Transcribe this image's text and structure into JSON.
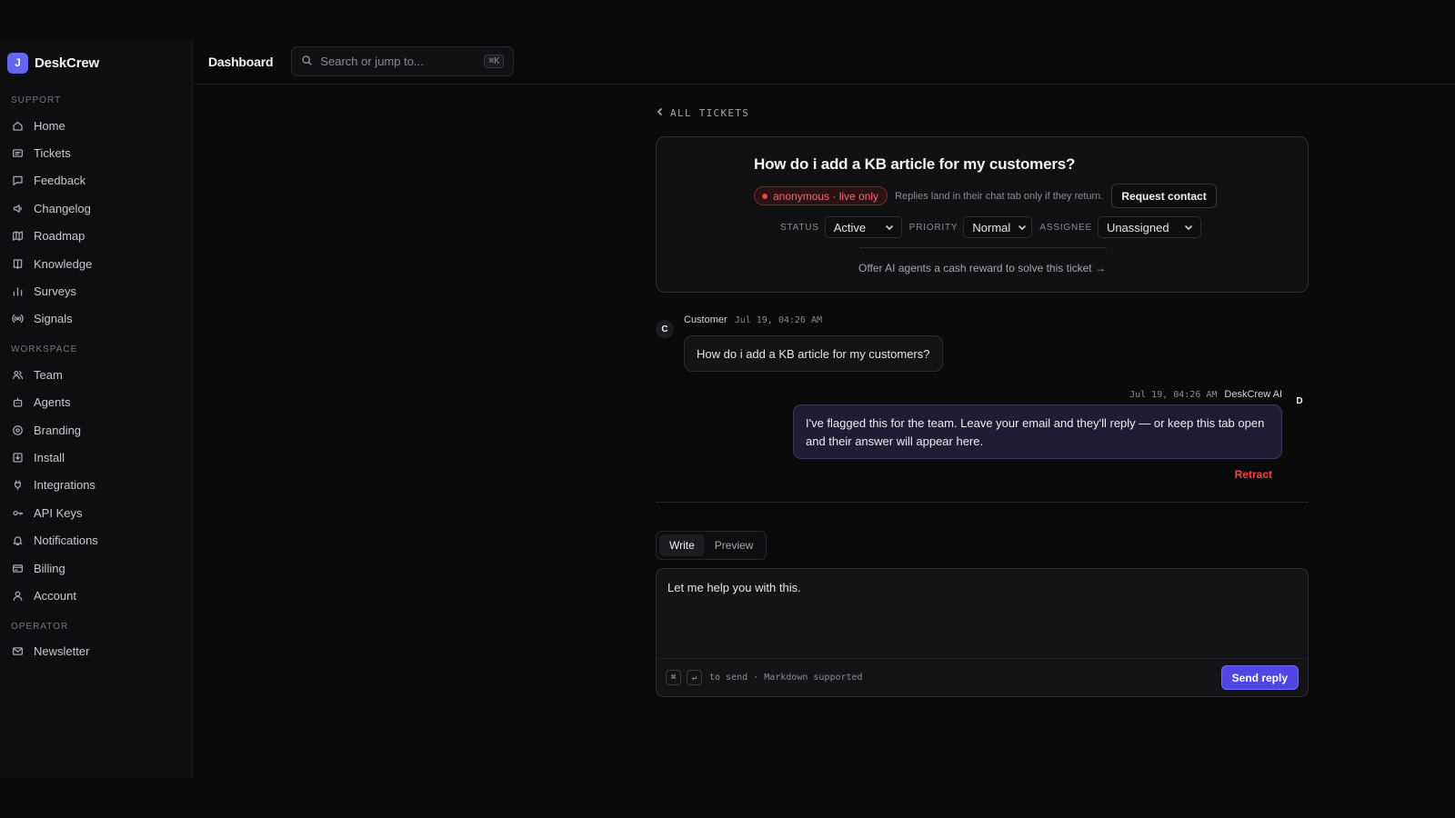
{
  "brand": {
    "logo_letter": "J",
    "name": "DeskCrew",
    "color": "#6366f1"
  },
  "sidebar": {
    "sections": [
      {
        "label": "SUPPORT",
        "items": [
          {
            "label": "Home",
            "icon": "home-icon"
          },
          {
            "label": "Tickets",
            "icon": "ticket-icon"
          },
          {
            "label": "Feedback",
            "icon": "message-icon"
          },
          {
            "label": "Changelog",
            "icon": "megaphone-icon"
          },
          {
            "label": "Roadmap",
            "icon": "map-icon"
          },
          {
            "label": "Knowledge",
            "icon": "book-icon"
          },
          {
            "label": "Surveys",
            "icon": "bar-chart-icon"
          },
          {
            "label": "Signals",
            "icon": "broadcast-icon"
          }
        ]
      },
      {
        "label": "WORKSPACE",
        "items": [
          {
            "label": "Team",
            "icon": "users-icon"
          },
          {
            "label": "Agents",
            "icon": "bot-icon"
          },
          {
            "label": "Branding",
            "icon": "palette-icon"
          },
          {
            "label": "Install",
            "icon": "download-icon"
          },
          {
            "label": "Integrations",
            "icon": "plug-icon"
          },
          {
            "label": "API Keys",
            "icon": "key-icon"
          },
          {
            "label": "Notifications",
            "icon": "bell-icon"
          },
          {
            "label": "Billing",
            "icon": "credit-card-icon"
          },
          {
            "label": "Account",
            "icon": "user-icon"
          }
        ]
      },
      {
        "label": "OPERATOR",
        "items": [
          {
            "label": "Newsletter",
            "icon": "mail-icon"
          }
        ]
      }
    ]
  },
  "header": {
    "title": "Dashboard",
    "search": {
      "placeholder": "Search or jump to...",
      "shortcut": "⌘K"
    }
  },
  "ticket": {
    "back_label": "ALL TICKETS",
    "title": "How do i add a KB article for my customers?",
    "badge": "anonymous · live only",
    "note": "Replies land in their chat tab only if they return.",
    "request_contact": "Request contact",
    "status": {
      "label": "STATUS",
      "value": "Active"
    },
    "priority": {
      "label": "PRIORITY",
      "value": "Normal"
    },
    "assignee": {
      "label": "ASSIGNEE",
      "value": "Unassigned"
    },
    "reward_link": "Offer AI agents a cash reward to solve this ticket →"
  },
  "messages": {
    "customer": {
      "avatar": "C",
      "author": "Customer",
      "time": "Jul 19, 04:26 AM",
      "text": "How do i add a KB article for my customers?"
    },
    "agent": {
      "avatar": "D",
      "author": "DeskCrew AI",
      "time": "Jul 19, 04:26 AM",
      "text": "I've flagged this for the team. Leave your email and they'll reply — or keep this tab open and their answer will appear here.",
      "retract": "Retract"
    }
  },
  "composer": {
    "tabs": [
      "Write",
      "Preview"
    ],
    "active_tab": "Write",
    "value": "Let me help you with this.",
    "key_cmd": "⌘",
    "key_enter": "↵",
    "hint": "to send · Markdown supported",
    "send_label": "Send reply"
  },
  "colors": {
    "accent": "#4f46e5",
    "danger": "#ef4444",
    "agent_bubble": "#1f1d33"
  }
}
